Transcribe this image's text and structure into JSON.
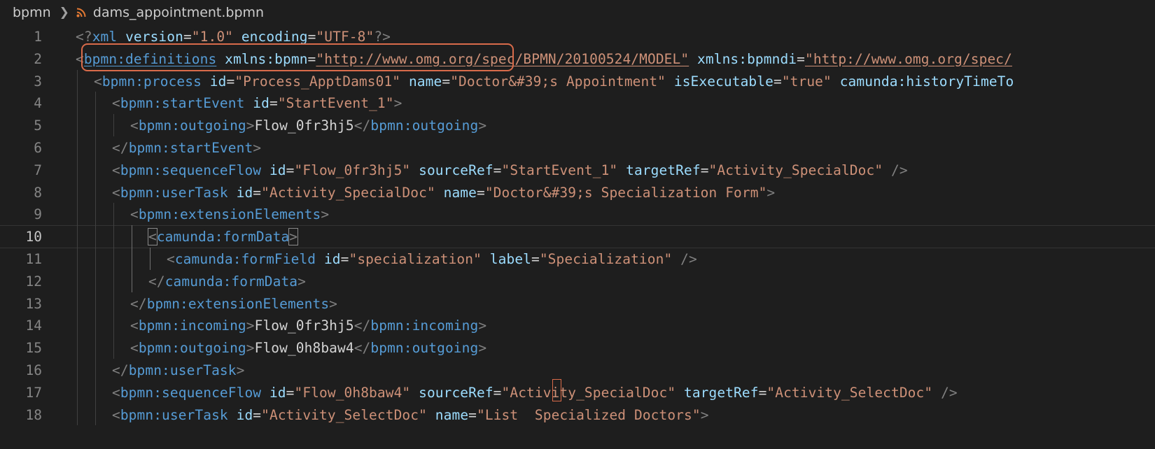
{
  "breadcrumb": {
    "folder": "bpmn",
    "file": "dams_appointment.bpmn"
  },
  "editor": {
    "current_line": 10,
    "lines": [
      {
        "n": "1",
        "indent": 0,
        "tokens": [
          [
            "p",
            "<?"
          ],
          [
            "t",
            "xml"
          ],
          [
            "x",
            " "
          ],
          [
            "a",
            "version"
          ],
          [
            "x",
            "="
          ],
          [
            "s",
            "\"1.0\""
          ],
          [
            "x",
            " "
          ],
          [
            "a",
            "encoding"
          ],
          [
            "x",
            "="
          ],
          [
            "s",
            "\"UTF-8\""
          ],
          [
            "p",
            "?>"
          ]
        ]
      },
      {
        "n": "2",
        "indent": 0,
        "tokens": [
          [
            "p",
            "<"
          ],
          [
            "t",
            "bpmn:definitions"
          ],
          [
            "x",
            " "
          ],
          [
            "a",
            "xmlns:bpmn"
          ],
          [
            "x",
            "="
          ],
          [
            "s",
            "\"http://www.omg.org/spec/BPMN/20100524/MODEL\""
          ],
          [
            "x",
            " "
          ],
          [
            "a",
            "xmlns:bpmndi"
          ],
          [
            "x",
            "="
          ],
          [
            "s",
            "\"http://www.omg.org/spec/"
          ]
        ]
      },
      {
        "n": "3",
        "indent": 1,
        "tokens": [
          [
            "p",
            "<"
          ],
          [
            "t",
            "bpmn:process"
          ],
          [
            "x",
            " "
          ],
          [
            "a",
            "id"
          ],
          [
            "x",
            "="
          ],
          [
            "s",
            "\"Process_ApptDams01\""
          ],
          [
            "x",
            " "
          ],
          [
            "a",
            "name"
          ],
          [
            "x",
            "="
          ],
          [
            "s",
            "\"Doctor&#39;s Appointment\""
          ],
          [
            "x",
            " "
          ],
          [
            "a",
            "isExecutable"
          ],
          [
            "x",
            "="
          ],
          [
            "s",
            "\"true\""
          ],
          [
            "x",
            " "
          ],
          [
            "a",
            "camunda:historyTimeTo"
          ]
        ]
      },
      {
        "n": "4",
        "indent": 2,
        "tokens": [
          [
            "p",
            "<"
          ],
          [
            "t",
            "bpmn:startEvent"
          ],
          [
            "x",
            " "
          ],
          [
            "a",
            "id"
          ],
          [
            "x",
            "="
          ],
          [
            "s",
            "\"StartEvent_1\""
          ],
          [
            "p",
            ">"
          ]
        ]
      },
      {
        "n": "5",
        "indent": 3,
        "tokens": [
          [
            "p",
            "<"
          ],
          [
            "t",
            "bpmn:outgoing"
          ],
          [
            "p",
            ">"
          ],
          [
            "x",
            "Flow_0fr3hj5"
          ],
          [
            "p",
            "</"
          ],
          [
            "t",
            "bpmn:outgoing"
          ],
          [
            "p",
            ">"
          ]
        ]
      },
      {
        "n": "6",
        "indent": 2,
        "tokens": [
          [
            "p",
            "</"
          ],
          [
            "t",
            "bpmn:startEvent"
          ],
          [
            "p",
            ">"
          ]
        ]
      },
      {
        "n": "7",
        "indent": 2,
        "tokens": [
          [
            "p",
            "<"
          ],
          [
            "t",
            "bpmn:sequenceFlow"
          ],
          [
            "x",
            " "
          ],
          [
            "a",
            "id"
          ],
          [
            "x",
            "="
          ],
          [
            "s",
            "\"Flow_0fr3hj5\""
          ],
          [
            "x",
            " "
          ],
          [
            "a",
            "sourceRef"
          ],
          [
            "x",
            "="
          ],
          [
            "s",
            "\"StartEvent_1\""
          ],
          [
            "x",
            " "
          ],
          [
            "a",
            "targetRef"
          ],
          [
            "x",
            "="
          ],
          [
            "s",
            "\"Activity_SpecialDoc\""
          ],
          [
            "x",
            " "
          ],
          [
            "p",
            "/>"
          ]
        ]
      },
      {
        "n": "8",
        "indent": 2,
        "tokens": [
          [
            "p",
            "<"
          ],
          [
            "t",
            "bpmn:userTask"
          ],
          [
            "x",
            " "
          ],
          [
            "a",
            "id"
          ],
          [
            "x",
            "="
          ],
          [
            "s",
            "\"Activity_SpecialDoc\""
          ],
          [
            "x",
            " "
          ],
          [
            "a",
            "name"
          ],
          [
            "x",
            "="
          ],
          [
            "s",
            "\"Doctor&#39;s Specialization Form\""
          ],
          [
            "p",
            ">"
          ]
        ]
      },
      {
        "n": "9",
        "indent": 3,
        "tokens": [
          [
            "p",
            "<"
          ],
          [
            "t",
            "bpmn:extensionElements"
          ],
          [
            "p",
            ">"
          ]
        ]
      },
      {
        "n": "10",
        "indent": 4,
        "tokens": [
          [
            "p",
            "<"
          ],
          [
            "t",
            "camunda:formData"
          ],
          [
            "p",
            ">"
          ]
        ]
      },
      {
        "n": "11",
        "indent": 5,
        "tokens": [
          [
            "p",
            "<"
          ],
          [
            "t",
            "camunda:formField"
          ],
          [
            "x",
            " "
          ],
          [
            "a",
            "id"
          ],
          [
            "x",
            "="
          ],
          [
            "s",
            "\"specialization\""
          ],
          [
            "x",
            " "
          ],
          [
            "a",
            "label"
          ],
          [
            "x",
            "="
          ],
          [
            "s",
            "\"Specialization\""
          ],
          [
            "x",
            " "
          ],
          [
            "p",
            "/>"
          ]
        ]
      },
      {
        "n": "12",
        "indent": 4,
        "tokens": [
          [
            "p",
            "</"
          ],
          [
            "t",
            "camunda:formData"
          ],
          [
            "p",
            ">"
          ]
        ]
      },
      {
        "n": "13",
        "indent": 3,
        "tokens": [
          [
            "p",
            "</"
          ],
          [
            "t",
            "bpmn:extensionElements"
          ],
          [
            "p",
            ">"
          ]
        ]
      },
      {
        "n": "14",
        "indent": 3,
        "tokens": [
          [
            "p",
            "<"
          ],
          [
            "t",
            "bpmn:incoming"
          ],
          [
            "p",
            ">"
          ],
          [
            "x",
            "Flow_0fr3hj5"
          ],
          [
            "p",
            "</"
          ],
          [
            "t",
            "bpmn:incoming"
          ],
          [
            "p",
            ">"
          ]
        ]
      },
      {
        "n": "15",
        "indent": 3,
        "tokens": [
          [
            "p",
            "<"
          ],
          [
            "t",
            "bpmn:outgoing"
          ],
          [
            "p",
            ">"
          ],
          [
            "x",
            "Flow_0h8baw4"
          ],
          [
            "p",
            "</"
          ],
          [
            "t",
            "bpmn:outgoing"
          ],
          [
            "p",
            ">"
          ]
        ]
      },
      {
        "n": "16",
        "indent": 2,
        "tokens": [
          [
            "p",
            "</"
          ],
          [
            "t",
            "bpmn:userTask"
          ],
          [
            "p",
            ">"
          ]
        ]
      },
      {
        "n": "17",
        "indent": 2,
        "tokens": [
          [
            "p",
            "<"
          ],
          [
            "t",
            "bpmn:sequenceFlow"
          ],
          [
            "x",
            " "
          ],
          [
            "a",
            "id"
          ],
          [
            "x",
            "="
          ],
          [
            "s",
            "\"Flow_0h8baw4\""
          ],
          [
            "x",
            " "
          ],
          [
            "a",
            "sourceRef"
          ],
          [
            "x",
            "="
          ],
          [
            "s",
            "\"Activity_SpecialDoc\""
          ],
          [
            "x",
            " "
          ],
          [
            "a",
            "targetRef"
          ],
          [
            "x",
            "="
          ],
          [
            "s",
            "\"Activity_SelectDoc\""
          ],
          [
            "x",
            " "
          ],
          [
            "p",
            "/>"
          ]
        ]
      },
      {
        "n": "18",
        "indent": 2,
        "tokens": [
          [
            "p",
            "<"
          ],
          [
            "t",
            "bpmn:userTask"
          ],
          [
            "x",
            " "
          ],
          [
            "a",
            "id"
          ],
          [
            "x",
            "="
          ],
          [
            "s",
            "\"Activity_SelectDoc\""
          ],
          [
            "x",
            " "
          ],
          [
            "a",
            "name"
          ],
          [
            "x",
            "="
          ],
          [
            "s",
            "\"List  Specialized Doctors\""
          ],
          [
            "p",
            ">"
          ]
        ]
      }
    ]
  },
  "colors": {
    "background": "#1e1e1e",
    "tag": "#569cd6",
    "attribute": "#9cdcfe",
    "string": "#ce9178",
    "punctuation": "#808080",
    "annotation": "#d96b4a"
  },
  "icons": [
    "chevron-right-icon",
    "rss-icon"
  ]
}
